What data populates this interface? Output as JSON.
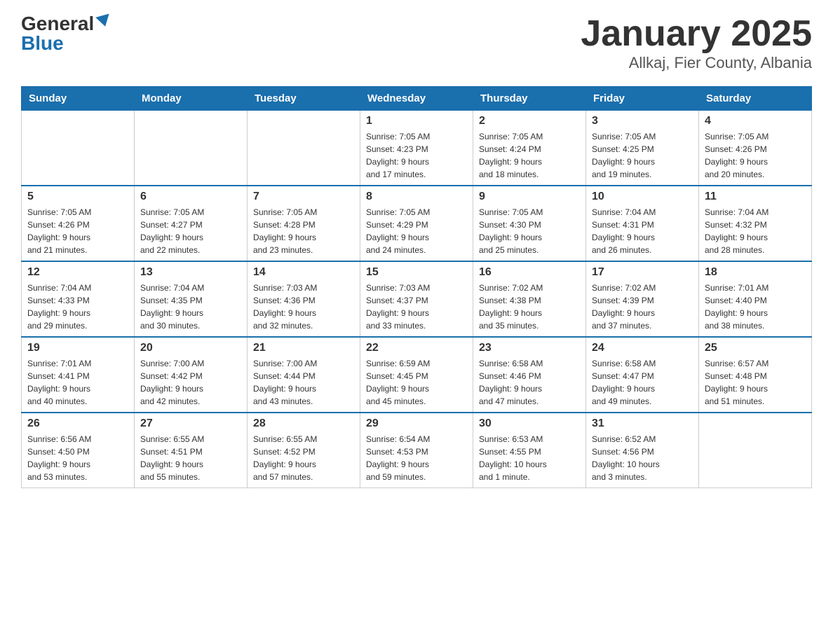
{
  "header": {
    "logo_general": "General",
    "logo_blue": "Blue",
    "month_title": "January 2025",
    "subtitle": "Allkaj, Fier County, Albania"
  },
  "days_of_week": [
    "Sunday",
    "Monday",
    "Tuesday",
    "Wednesday",
    "Thursday",
    "Friday",
    "Saturday"
  ],
  "weeks": [
    [
      {
        "day": "",
        "info": ""
      },
      {
        "day": "",
        "info": ""
      },
      {
        "day": "",
        "info": ""
      },
      {
        "day": "1",
        "info": "Sunrise: 7:05 AM\nSunset: 4:23 PM\nDaylight: 9 hours\nand 17 minutes."
      },
      {
        "day": "2",
        "info": "Sunrise: 7:05 AM\nSunset: 4:24 PM\nDaylight: 9 hours\nand 18 minutes."
      },
      {
        "day": "3",
        "info": "Sunrise: 7:05 AM\nSunset: 4:25 PM\nDaylight: 9 hours\nand 19 minutes."
      },
      {
        "day": "4",
        "info": "Sunrise: 7:05 AM\nSunset: 4:26 PM\nDaylight: 9 hours\nand 20 minutes."
      }
    ],
    [
      {
        "day": "5",
        "info": "Sunrise: 7:05 AM\nSunset: 4:26 PM\nDaylight: 9 hours\nand 21 minutes."
      },
      {
        "day": "6",
        "info": "Sunrise: 7:05 AM\nSunset: 4:27 PM\nDaylight: 9 hours\nand 22 minutes."
      },
      {
        "day": "7",
        "info": "Sunrise: 7:05 AM\nSunset: 4:28 PM\nDaylight: 9 hours\nand 23 minutes."
      },
      {
        "day": "8",
        "info": "Sunrise: 7:05 AM\nSunset: 4:29 PM\nDaylight: 9 hours\nand 24 minutes."
      },
      {
        "day": "9",
        "info": "Sunrise: 7:05 AM\nSunset: 4:30 PM\nDaylight: 9 hours\nand 25 minutes."
      },
      {
        "day": "10",
        "info": "Sunrise: 7:04 AM\nSunset: 4:31 PM\nDaylight: 9 hours\nand 26 minutes."
      },
      {
        "day": "11",
        "info": "Sunrise: 7:04 AM\nSunset: 4:32 PM\nDaylight: 9 hours\nand 28 minutes."
      }
    ],
    [
      {
        "day": "12",
        "info": "Sunrise: 7:04 AM\nSunset: 4:33 PM\nDaylight: 9 hours\nand 29 minutes."
      },
      {
        "day": "13",
        "info": "Sunrise: 7:04 AM\nSunset: 4:35 PM\nDaylight: 9 hours\nand 30 minutes."
      },
      {
        "day": "14",
        "info": "Sunrise: 7:03 AM\nSunset: 4:36 PM\nDaylight: 9 hours\nand 32 minutes."
      },
      {
        "day": "15",
        "info": "Sunrise: 7:03 AM\nSunset: 4:37 PM\nDaylight: 9 hours\nand 33 minutes."
      },
      {
        "day": "16",
        "info": "Sunrise: 7:02 AM\nSunset: 4:38 PM\nDaylight: 9 hours\nand 35 minutes."
      },
      {
        "day": "17",
        "info": "Sunrise: 7:02 AM\nSunset: 4:39 PM\nDaylight: 9 hours\nand 37 minutes."
      },
      {
        "day": "18",
        "info": "Sunrise: 7:01 AM\nSunset: 4:40 PM\nDaylight: 9 hours\nand 38 minutes."
      }
    ],
    [
      {
        "day": "19",
        "info": "Sunrise: 7:01 AM\nSunset: 4:41 PM\nDaylight: 9 hours\nand 40 minutes."
      },
      {
        "day": "20",
        "info": "Sunrise: 7:00 AM\nSunset: 4:42 PM\nDaylight: 9 hours\nand 42 minutes."
      },
      {
        "day": "21",
        "info": "Sunrise: 7:00 AM\nSunset: 4:44 PM\nDaylight: 9 hours\nand 43 minutes."
      },
      {
        "day": "22",
        "info": "Sunrise: 6:59 AM\nSunset: 4:45 PM\nDaylight: 9 hours\nand 45 minutes."
      },
      {
        "day": "23",
        "info": "Sunrise: 6:58 AM\nSunset: 4:46 PM\nDaylight: 9 hours\nand 47 minutes."
      },
      {
        "day": "24",
        "info": "Sunrise: 6:58 AM\nSunset: 4:47 PM\nDaylight: 9 hours\nand 49 minutes."
      },
      {
        "day": "25",
        "info": "Sunrise: 6:57 AM\nSunset: 4:48 PM\nDaylight: 9 hours\nand 51 minutes."
      }
    ],
    [
      {
        "day": "26",
        "info": "Sunrise: 6:56 AM\nSunset: 4:50 PM\nDaylight: 9 hours\nand 53 minutes."
      },
      {
        "day": "27",
        "info": "Sunrise: 6:55 AM\nSunset: 4:51 PM\nDaylight: 9 hours\nand 55 minutes."
      },
      {
        "day": "28",
        "info": "Sunrise: 6:55 AM\nSunset: 4:52 PM\nDaylight: 9 hours\nand 57 minutes."
      },
      {
        "day": "29",
        "info": "Sunrise: 6:54 AM\nSunset: 4:53 PM\nDaylight: 9 hours\nand 59 minutes."
      },
      {
        "day": "30",
        "info": "Sunrise: 6:53 AM\nSunset: 4:55 PM\nDaylight: 10 hours\nand 1 minute."
      },
      {
        "day": "31",
        "info": "Sunrise: 6:52 AM\nSunset: 4:56 PM\nDaylight: 10 hours\nand 3 minutes."
      },
      {
        "day": "",
        "info": ""
      }
    ]
  ]
}
